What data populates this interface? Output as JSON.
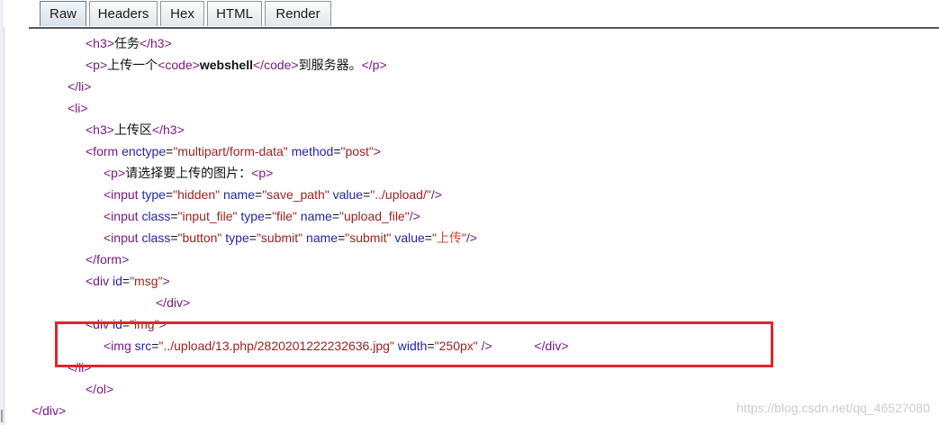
{
  "tabs": {
    "raw": "Raw",
    "headers": "Headers",
    "hex": "Hex",
    "html": "HTML",
    "render": "Render"
  },
  "code": {
    "l1": {
      "open": "<h3>",
      "text": "任务",
      "close": "</h3>"
    },
    "l2": {
      "p_open": "<p>",
      "text1": "上传一个",
      "code_open": "<code>",
      "bold": "webshell",
      "code_close": "</code>",
      "text2": "到服务器。",
      "p_close": "</p>"
    },
    "l3": {
      "tag": "</li>"
    },
    "l4": {
      "tag": "<li>"
    },
    "l5": {
      "open": "<h3>",
      "text": "上传区",
      "close": "</h3>"
    },
    "l6": {
      "tag_start": "<form",
      "attr1": "enctype",
      "eq1": "=",
      "val1": "\"multipart/form-data\"",
      "attr2": "method",
      "eq2": "=",
      "val2": "\"post\"",
      "tag_end": ">"
    },
    "l7": {
      "open": "<p>",
      "text": "请选择要上传的图片：",
      "close": "<p>"
    },
    "l8": {
      "tag_start": "<input",
      "attr1": "type",
      "val1": "\"hidden\"",
      "attr2": "name",
      "val2": "\"save_path\"",
      "attr3": "value",
      "val3": "\"../upload/\"",
      "tag_end": "/>"
    },
    "l9": {
      "tag_start": "<input",
      "attr1": "class",
      "val1": "\"input_file\"",
      "attr2": "type",
      "val2": "\"file\"",
      "attr3": "name",
      "val3": "\"upload_file\"",
      "tag_end": "/>"
    },
    "l10": {
      "tag_start": "<input",
      "attr1": "class",
      "val1": "\"button\"",
      "attr2": "type",
      "val2": "\"submit\"",
      "attr3": "name",
      "val3": "\"submit\"",
      "attr4": "value",
      "val4_q1": "\"",
      "val4": "上传",
      "val4_q2": "\"",
      "tag_end": "/>"
    },
    "l11": {
      "tag": "</form>"
    },
    "l12": {
      "tag_start": "<div",
      "attr1": "id",
      "val1": "\"msg\"",
      "tag_end": ">"
    },
    "l13": {
      "tag": "</div>"
    },
    "l14": {
      "tag_start": "<div",
      "attr1": "id",
      "val1": "\"img\"",
      "tag_end": ">"
    },
    "l15": {
      "tag_start": "<img",
      "attr1": "src",
      "val1": "\"../upload/13.php/2820201222232636.jpg\"",
      "attr2": "width",
      "val2": "\"250px\"",
      "tag_end": "/>",
      "div_close": "</div>"
    },
    "l16": {
      "tag": "</li>"
    },
    "l17": {
      "tag": "</ol>"
    },
    "l18": {
      "tag": "</div>"
    }
  },
  "watermark": "https://blog.csdn.net/qq_46527080",
  "colors": {
    "highlight_box": "#e0262b",
    "tag": "#7a1a82",
    "attribute": "#2424a8",
    "value": "#9c1f1f"
  }
}
